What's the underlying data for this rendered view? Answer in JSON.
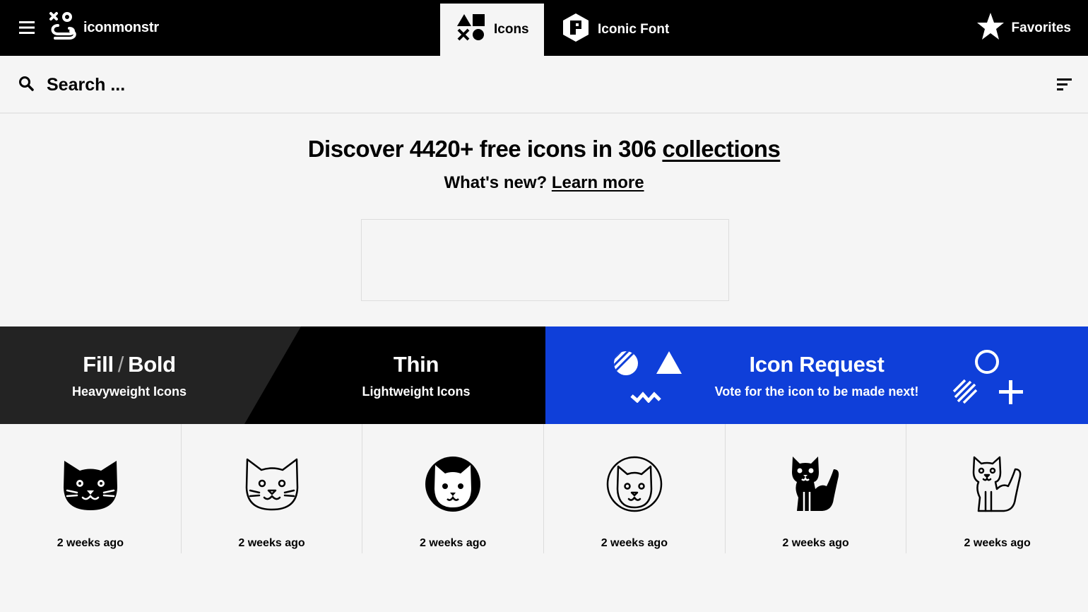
{
  "header": {
    "logo_text": "iconmonstr",
    "tabs": [
      {
        "label": "Icons",
        "active": true
      },
      {
        "label": "Iconic Font",
        "active": false
      }
    ],
    "favorites_label": "Favorites"
  },
  "search": {
    "placeholder": "Search ..."
  },
  "hero": {
    "title_prefix": "Discover 4420+ free icons in 306 ",
    "title_link": "collections",
    "subtitle_prefix": "What's new? ",
    "subtitle_link": "Learn more"
  },
  "banner": {
    "fill": {
      "title_a": "Fill",
      "slash": "/",
      "title_b": "Bold",
      "subtitle": "Heavyweight Icons"
    },
    "thin": {
      "title": "Thin",
      "subtitle": "Lightweight Icons"
    },
    "request": {
      "title": "Icon Request",
      "subtitle": "Vote for the icon to be made next!",
      "color": "#0f3fd9"
    }
  },
  "icons": [
    {
      "icon": "cat-face-fill-icon",
      "date": "2 weeks ago"
    },
    {
      "icon": "cat-face-thin-icon",
      "date": "2 weeks ago"
    },
    {
      "icon": "cat-circle-fill-icon",
      "date": "2 weeks ago"
    },
    {
      "icon": "cat-circle-thin-icon",
      "date": "2 weeks ago"
    },
    {
      "icon": "cat-sitting-fill-icon",
      "date": "2 weeks ago"
    },
    {
      "icon": "cat-sitting-thin-icon",
      "date": "2 weeks ago"
    }
  ]
}
